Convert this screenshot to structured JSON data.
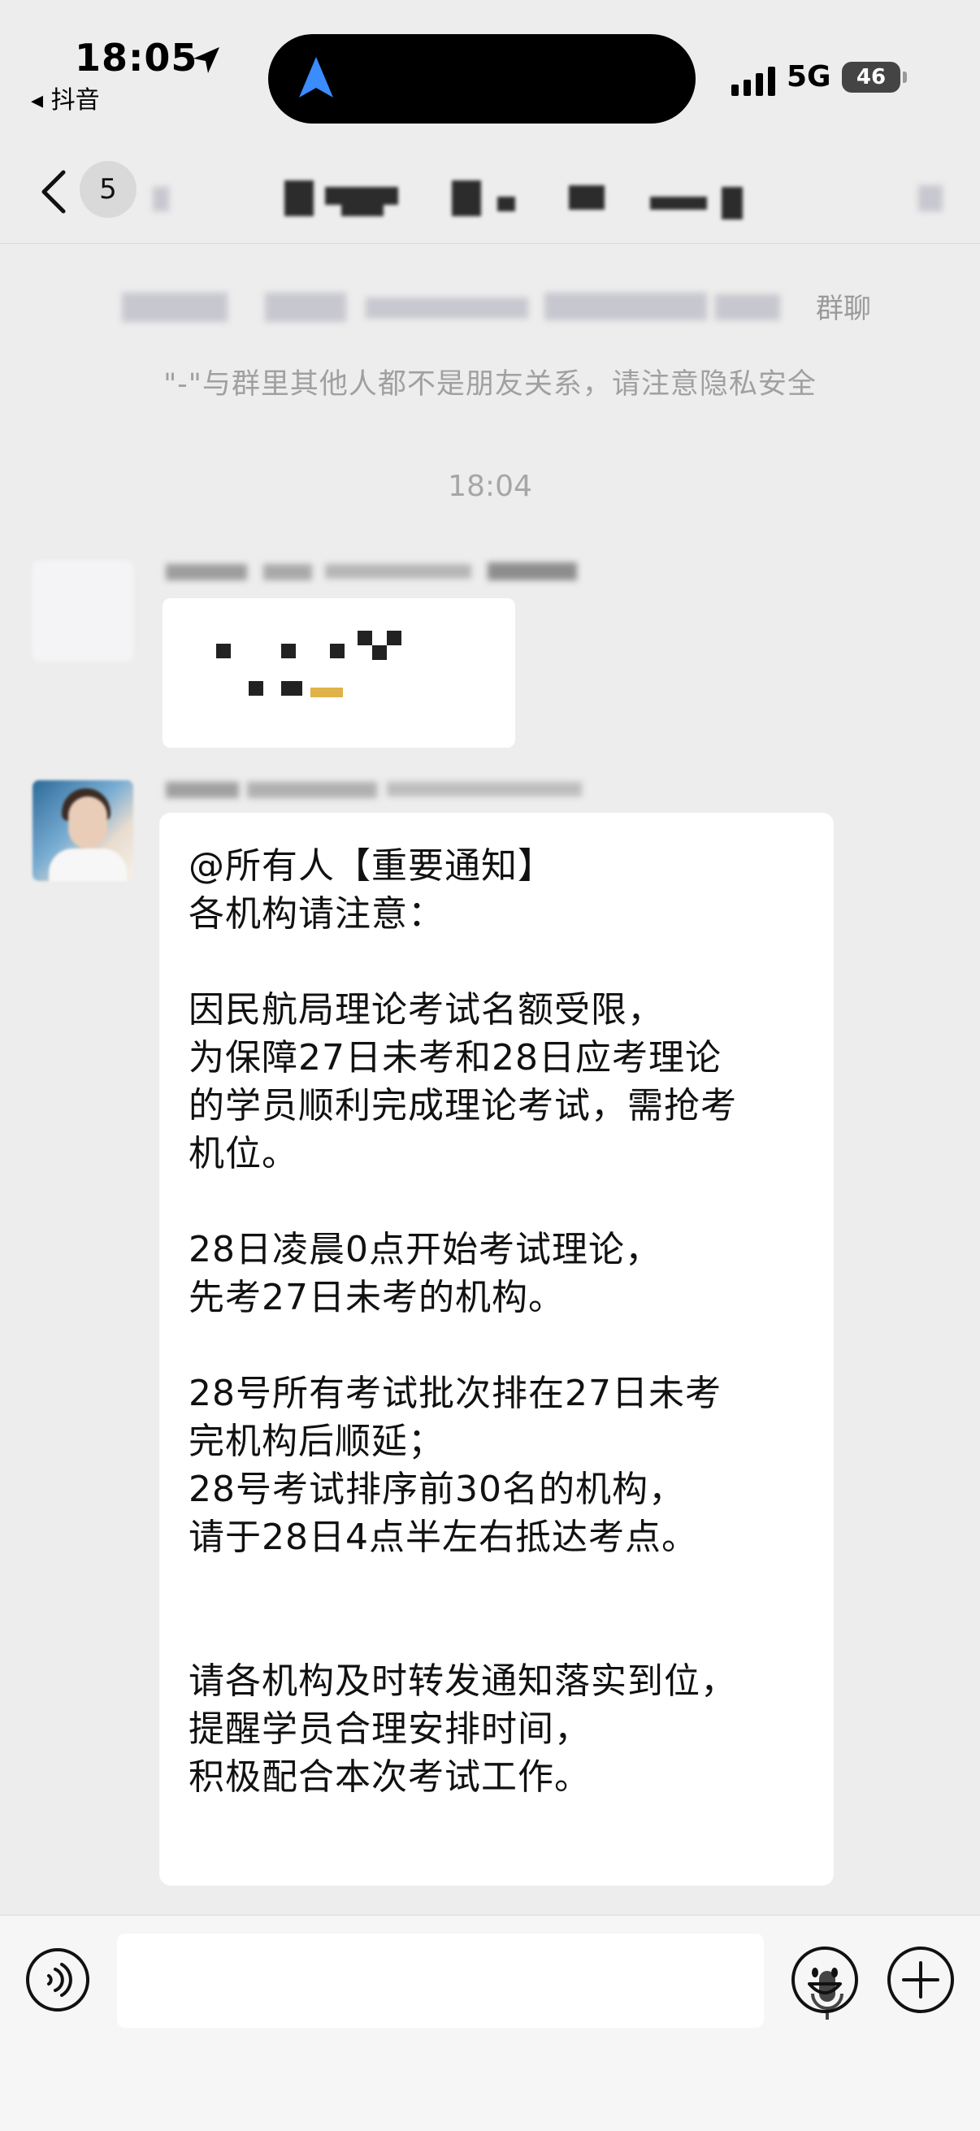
{
  "status_bar": {
    "time": "18:05",
    "back_app": "◂ 抖音",
    "network": "5G",
    "battery": "46"
  },
  "nav": {
    "unread_count": "5"
  },
  "chat": {
    "system_suffix": "群聊",
    "privacy_notice": "\"-\"与群里其他人都不是朋友关系，请注意隐私安全",
    "time_divider": "18:04",
    "notice_message": {
      "lines": [
        "@所有人【重要通知】",
        "各机构请注意：",
        "",
        "因民航局理论考试名额受限，",
        "为保障27日未考和28日应考理论",
        "的学员顺利完成理论考试，需抢考",
        "机位。",
        "",
        "28日凌晨0点开始考试理论，",
        "先考27日未考的机构。",
        "",
        "28号所有考试批次排在27日未考",
        "完机构后顺延；",
        "28号考试排序前30名的机构，",
        "请于28日4点半左右抵达考点。",
        "",
        "",
        "请各机构及时转发通知落实到位，",
        "提醒学员合理安排时间，",
        "积极配合本次考试工作。"
      ]
    }
  },
  "icons": {
    "location": "location-arrow-icon",
    "back": "chevron-left-icon",
    "voice": "voice-icon",
    "mic": "microphone-icon",
    "emoji": "emoji-icon",
    "plus": "plus-icon"
  },
  "colors": {
    "background": "#ededed",
    "bubble": "#ffffff",
    "system_text": "#a0a0a0",
    "island_arrow": "#3b8cff"
  }
}
